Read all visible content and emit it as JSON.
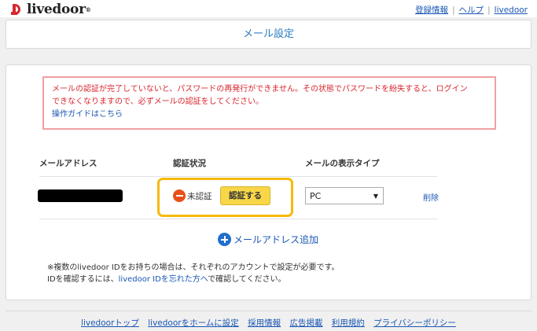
{
  "header": {
    "logo_text": "livedoor",
    "links": [
      "登録情報",
      "ヘルプ",
      "livedoor"
    ]
  },
  "page": {
    "title": "メール設定"
  },
  "alert": {
    "message_line1": "メールの認証が完了していないと、パスワードの再発行ができません。その状態でパスワードを紛失すると、ログイン",
    "message_line2": "できなくなりますので、必ずメールの認証をしてください。",
    "guide_link": "操作ガイドはこちら"
  },
  "table": {
    "headers": {
      "email": "メールアドレス",
      "status": "認証状況",
      "display_type": "メールの表示タイプ"
    },
    "row": {
      "status_text": "未認証",
      "verify_button": "認証する",
      "display_type_value": "PC",
      "delete_link": "削除"
    }
  },
  "add_email": {
    "label": "メールアドレス追加"
  },
  "note": {
    "line1": "※複数のlivedoor IDをお持ちの場合は、それぞれのアカウントで設定が必要です。",
    "line2_prefix": "IDを確認するには、",
    "line2_link": "livedoor IDを忘れた方へ",
    "line2_suffix": "で確認してください。"
  },
  "footer": {
    "links": [
      "livedoorトップ",
      "livedoorをホームに設定",
      "採用情報",
      "広告掲載",
      "利用規約",
      "プライバシーポリシー"
    ]
  },
  "colors": {
    "brand_red": "#d7282f",
    "link_blue": "#1a57b3",
    "title_blue": "#2a7cbf",
    "alert_text": "#d8262e",
    "highlight": "#f5ba0a",
    "verify_button": "#f7d748",
    "status_icon": "#e8501a"
  },
  "icons": {
    "logo": "livedoor-logo-icon",
    "status": "minus-circle-icon",
    "add": "plus-circle-icon",
    "select_caret": "chevron-down-icon"
  }
}
